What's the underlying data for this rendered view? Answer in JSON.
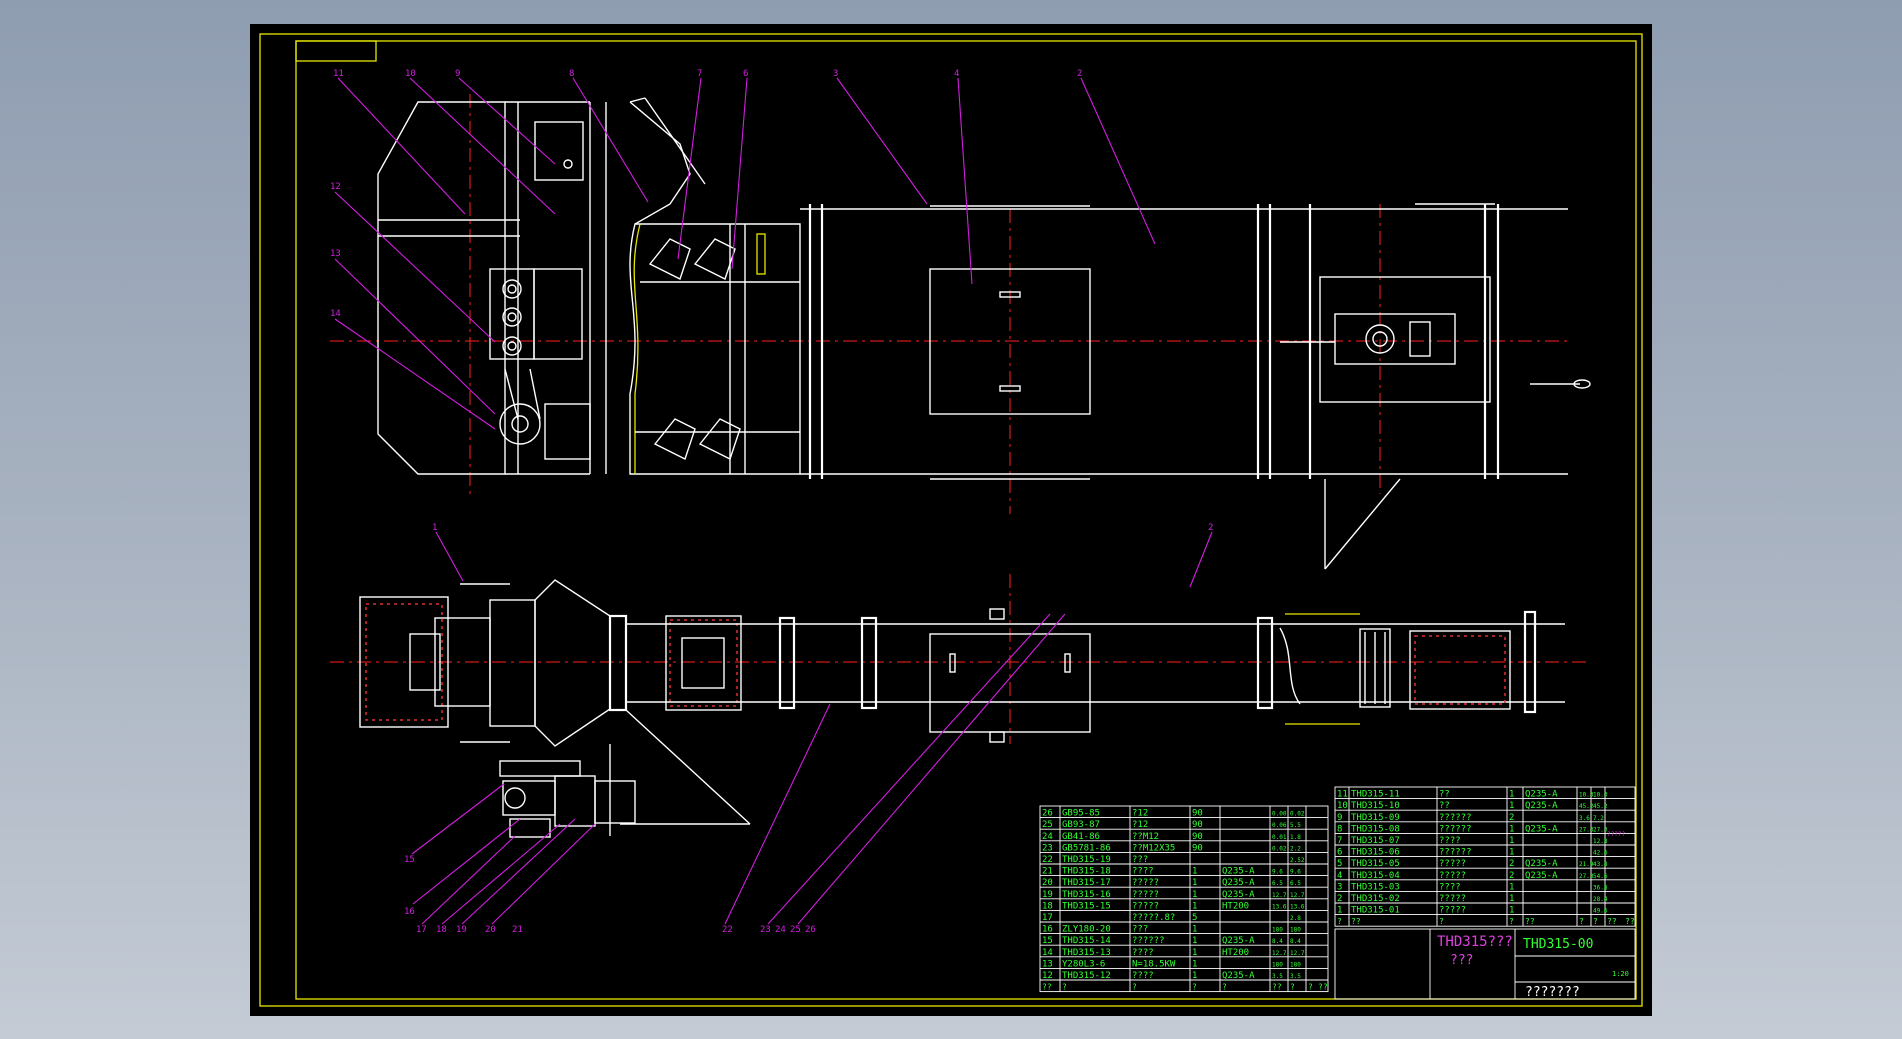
{
  "callouts": {
    "top": [
      "11",
      "10",
      "9",
      "8",
      "7",
      "6",
      "3",
      "4",
      "2",
      "12",
      "13",
      "14"
    ],
    "bottom": [
      "1",
      "2",
      "15",
      "16",
      "17",
      "18",
      "19",
      "20",
      "21",
      "22",
      "23",
      "24",
      "25",
      "26"
    ]
  },
  "bom_left": [
    {
      "no": "26",
      "code": "GB95-85",
      "name": "?12",
      "qty": "90",
      "mat": "",
      "w1": "0.00",
      "w2": "0.02"
    },
    {
      "no": "25",
      "code": "GB93-87",
      "name": "?12",
      "qty": "90",
      "mat": "",
      "w1": "0.06",
      "w2": "5.5"
    },
    {
      "no": "24",
      "code": "GB41-86",
      "name": "??M12",
      "qty": "90",
      "mat": "",
      "w1": "0.01",
      "w2": "1.8"
    },
    {
      "no": "23",
      "code": "GB5781-86",
      "name": "??M12X35",
      "qty": "90",
      "mat": "",
      "w1": "0.02",
      "w2": "2.2"
    },
    {
      "no": "22",
      "code": "THD315-19",
      "name": "???",
      "qty": "",
      "mat": "",
      "w1": "",
      "w2": "2.52"
    },
    {
      "no": "21",
      "code": "THD315-18",
      "name": "????",
      "qty": "1",
      "mat": "Q235-A",
      "w1": "9.6",
      "w2": "9.6"
    },
    {
      "no": "20",
      "code": "THD315-17",
      "name": "?????",
      "qty": "1",
      "mat": "Q235-A",
      "w1": "6.5",
      "w2": "6.5"
    },
    {
      "no": "19",
      "code": "THD315-16",
      "name": "?????",
      "qty": "1",
      "mat": "Q235-A",
      "w1": "12.7",
      "w2": "12.7"
    },
    {
      "no": "18",
      "code": "THD315-15",
      "name": "?????",
      "qty": "1",
      "mat": "HT200",
      "w1": "13.6",
      "w2": "13.6"
    },
    {
      "no": "17",
      "code": "",
      "name": "?????.8?",
      "qty": "5",
      "mat": "",
      "w1": "",
      "w2": "2.8"
    },
    {
      "no": "16",
      "code": "ZLY180-20",
      "name": "???",
      "qty": "1",
      "mat": "",
      "w1": "180",
      "w2": "180"
    },
    {
      "no": "15",
      "code": "THD315-14",
      "name": "??????",
      "qty": "1",
      "mat": "Q235-A",
      "w1": "8.4",
      "w2": "8.4"
    },
    {
      "no": "14",
      "code": "THD315-13",
      "name": "????",
      "qty": "1",
      "mat": "HT200",
      "w1": "12.7",
      "w2": "12.7"
    },
    {
      "no": "13",
      "code": "Y280L3-6",
      "name": "N=18.5KW",
      "qty": "1",
      "mat": "",
      "w1": "180",
      "w2": "180"
    },
    {
      "no": "12",
      "code": "THD315-12",
      "name": "????",
      "qty": "1",
      "mat": "Q235-A",
      "w1": "3.5",
      "w2": "3.5"
    }
  ],
  "bom_left_header": [
    "??",
    "?",
    "?",
    "?",
    "?",
    "??",
    "?",
    "?",
    "??"
  ],
  "bom_right": [
    {
      "no": "11",
      "code": "THD315-11",
      "name": "??",
      "qty": "1",
      "mat": "Q235-A",
      "w1": "10.3",
      "w2": "10.3"
    },
    {
      "no": "10",
      "code": "THD315-10",
      "name": "??",
      "qty": "1",
      "mat": "Q235-A",
      "w1": "45.2",
      "w2": "45.2"
    },
    {
      "no": "9",
      "code": "THD315-09",
      "name": "??????",
      "qty": "2",
      "mat": "",
      "w1": "3.6",
      "w2": "7.2"
    },
    {
      "no": "8",
      "code": "THD315-08",
      "name": "??????",
      "qty": "1",
      "mat": "Q235-A",
      "w1": "27.3",
      "w2": "27.3"
    },
    {
      "no": "7",
      "code": "THD315-07",
      "name": "????",
      "qty": "1",
      "mat": "",
      "w1": "",
      "w2": "12.8"
    },
    {
      "no": "6",
      "code": "THD315-06",
      "name": "??????",
      "qty": "1",
      "mat": "",
      "w1": "",
      "w2": "42.6"
    },
    {
      "no": "5",
      "code": "THD315-05",
      "name": "?????",
      "qty": "2",
      "mat": "Q235-A",
      "w1": "21.9",
      "w2": "43.8"
    },
    {
      "no": "4",
      "code": "THD315-04",
      "name": "?????",
      "qty": "2",
      "mat": "Q235-A",
      "w1": "27.3",
      "w2": "54.6"
    },
    {
      "no": "3",
      "code": "THD315-03",
      "name": "????",
      "qty": "1",
      "mat": "",
      "w1": "",
      "w2": "36.8"
    },
    {
      "no": "2",
      "code": "THD315-02",
      "name": "?????",
      "qty": "1",
      "mat": "",
      "w1": "",
      "w2": "28.4"
    },
    {
      "no": "1",
      "code": "THD315-01",
      "name": "?????",
      "qty": "1",
      "mat": "",
      "w1": "",
      "w2": "49.6"
    }
  ],
  "bom_right_header": [
    "?",
    "??",
    "?",
    "?",
    "??",
    "?",
    "?",
    "??",
    "??"
  ],
  "bom_note": "?????",
  "title_block": {
    "title_line1": "THD315???",
    "title_line2": "???",
    "drawing_no": "THD315-00",
    "scale": "1:20",
    "company": "???????"
  },
  "colors": {
    "sheet": "#000000",
    "lines": "#ffffff",
    "center": "#ff2020",
    "leader": "#d21ee0",
    "frame": "#e8e800",
    "table": "#33ff33"
  }
}
